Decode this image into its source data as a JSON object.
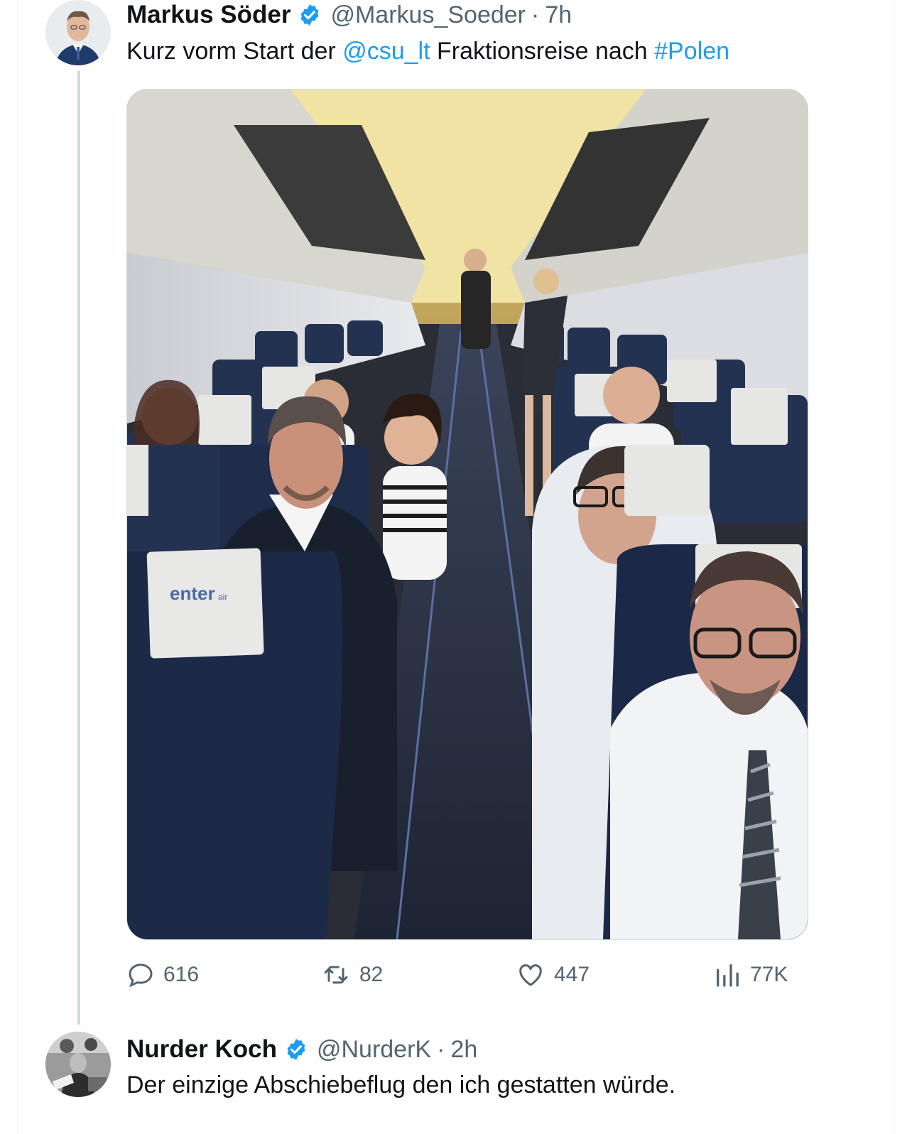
{
  "tweet1": {
    "name": "Markus Söder",
    "handle": "@Markus_Soeder",
    "separator": "·",
    "time": "7h",
    "text_before": "Kurz vorm Start der ",
    "mention": "@csu_lt",
    "text_middle": " Fraktionsreise nach ",
    "hashtag": "#Polen",
    "image_text": {
      "seat_brand": "enter",
      "seat_brand_suffix": "air"
    },
    "actions": {
      "replies": "616",
      "retweets": "82",
      "likes": "447",
      "views": "77K"
    }
  },
  "tweet2": {
    "name": "Nurder Koch",
    "handle": "@NurderK",
    "separator": "·",
    "time": "2h",
    "text": "Der einzige Abschiebeflug den ich gestatten würde."
  },
  "colors": {
    "link": "#1d9bf0",
    "verified": "#1d9bf0",
    "muted": "#536471",
    "text": "#0f1419"
  },
  "icons": [
    "verified-badge-icon",
    "reply-icon",
    "retweet-icon",
    "like-icon",
    "views-icon"
  ]
}
